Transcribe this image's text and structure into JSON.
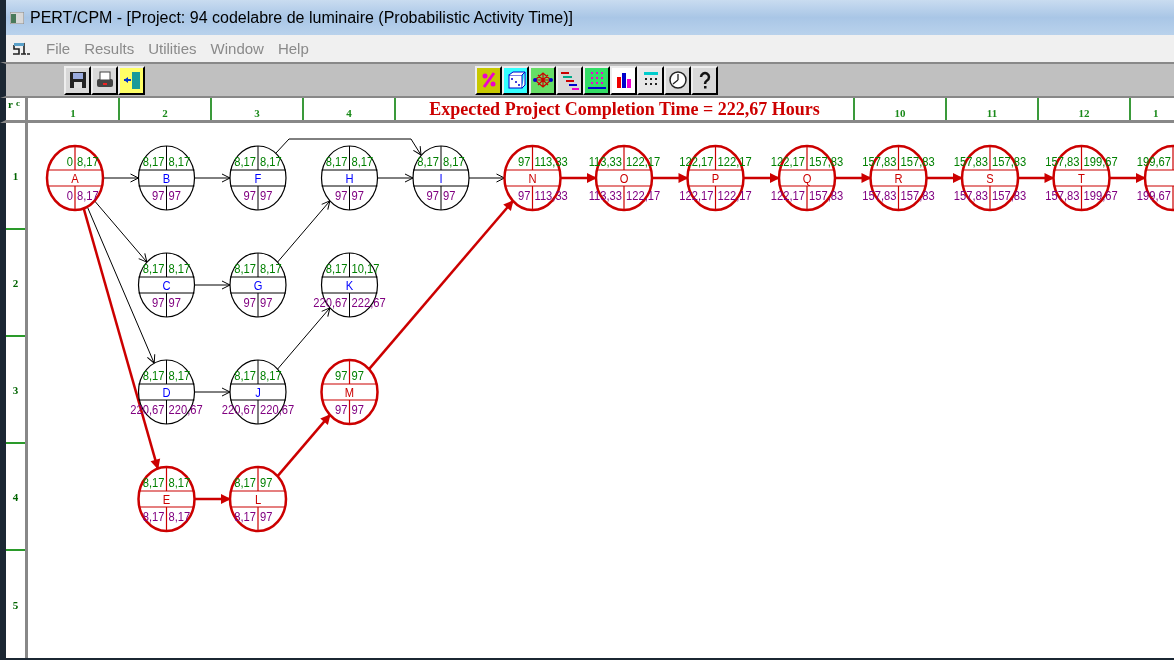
{
  "window": {
    "title": "PERT/CPM - [Project: 94 codelabre de luminaire (Probabilistic Activity Time)]"
  },
  "menu": [
    {
      "label": "File",
      "disabled": true
    },
    {
      "label": "Results",
      "disabled": true
    },
    {
      "label": "Utilities",
      "disabled": true
    },
    {
      "label": "Window",
      "disabled": true
    },
    {
      "label": "Help",
      "disabled": true
    }
  ],
  "toolbar": {
    "left": [
      {
        "kind": "save"
      },
      {
        "kind": "print"
      },
      {
        "kind": "exit"
      }
    ],
    "right": [
      {
        "kind": "percent"
      },
      {
        "kind": "dice"
      },
      {
        "kind": "network"
      },
      {
        "kind": "gantt"
      },
      {
        "kind": "grid"
      },
      {
        "kind": "bars"
      },
      {
        "kind": "calculator"
      },
      {
        "kind": "clock"
      },
      {
        "kind": "help"
      }
    ]
  },
  "grid": {
    "corner_row": "r",
    "corner_column": "c",
    "columns_before": [
      "1",
      "2",
      "3",
      "4"
    ],
    "summary": "Expected Project Completion Time = 222,67 Hours",
    "columns_after": [
      "10",
      "11",
      "12",
      "1"
    ],
    "rows": [
      "1",
      "2",
      "3",
      "4",
      "5"
    ]
  },
  "network": {
    "rows": [
      {
        "cells": [
          {
            "kind": "activity",
            "label": "A",
            "es": "0",
            "ef": "8,17",
            "ls": "0",
            "lf": "8,17",
            "critical": true
          },
          {
            "kind": "activity",
            "label": "B",
            "es": "8,17",
            "ef": "8,17",
            "ls": "97",
            "lf": "97",
            "critical": false
          },
          {
            "kind": "activity",
            "label": "F",
            "es": "8,17",
            "ef": "8,17",
            "ls": "97",
            "lf": "97",
            "critical": false
          },
          {
            "kind": "activity",
            "label": "H",
            "es": "8,17",
            "ef": "8,17",
            "ls": "97",
            "lf": "97",
            "critical": false
          },
          {
            "kind": "activity",
            "label": "I",
            "es": "8,17",
            "ef": "8,17",
            "ls": "97",
            "lf": "97",
            "critical": false
          },
          {
            "kind": "activity",
            "label": "N",
            "es": "97",
            "ef": "113,33",
            "ls": "97",
            "lf": "113,33",
            "critical": true
          },
          {
            "kind": "activity",
            "label": "O",
            "es": "113,33",
            "ef": "122,17",
            "ls": "113,33",
            "lf": "122,17",
            "critical": true
          },
          {
            "kind": "activity",
            "label": "P",
            "es": "122,17",
            "ef": "122,17",
            "ls": "122,17",
            "lf": "122,17",
            "critical": true
          },
          {
            "kind": "activity",
            "label": "Q",
            "es": "122,17",
            "ef": "157,83",
            "ls": "122,17",
            "lf": "157,83",
            "critical": true
          },
          {
            "kind": "activity",
            "label": "R",
            "es": "157,83",
            "ef": "157,83",
            "ls": "157,83",
            "lf": "157,83",
            "critical": true
          },
          {
            "kind": "activity",
            "label": "S",
            "es": "157,83",
            "ef": "157,83",
            "ls": "157,83",
            "lf": "157,83",
            "critical": true
          },
          {
            "kind": "activity",
            "label": "T",
            "es": "157,83",
            "ef": "199,67",
            "ls": "157,83",
            "lf": "199,67",
            "critical": true
          },
          {
            "kind": "activity",
            "es": "199,67",
            "ls": "199,67",
            "critical": true
          }
        ]
      },
      {
        "cells": [
          {
            "kind": "empty"
          },
          {
            "kind": "activity",
            "label": "C",
            "es": "8,17",
            "ef": "8,17",
            "ls": "97",
            "lf": "97",
            "critical": false
          },
          {
            "kind": "activity",
            "label": "G",
            "es": "8,17",
            "ef": "8,17",
            "ls": "97",
            "lf": "97",
            "critical": false
          },
          {
            "kind": "activity",
            "label": "K",
            "es": "8,17",
            "ef": "10,17",
            "ls": "220,67",
            "lf": "222,67",
            "critical": false
          }
        ]
      },
      {
        "cells": [
          {
            "kind": "empty"
          },
          {
            "kind": "activity",
            "label": "D",
            "es": "8,17",
            "ef": "8,17",
            "ls": "220,67",
            "lf": "220,67",
            "critical": false
          },
          {
            "kind": "activity",
            "label": "J",
            "es": "8,17",
            "ef": "8,17",
            "ls": "220,67",
            "lf": "220,67",
            "critical": false
          },
          {
            "kind": "activity",
            "label": "M",
            "es": "97",
            "ef": "97",
            "ls": "97",
            "lf": "97",
            "critical": true
          }
        ]
      },
      {
        "cells": [
          {
            "kind": "empty"
          },
          {
            "kind": "activity",
            "label": "E",
            "es": "8,17",
            "ef": "8,17",
            "ls": "8,17",
            "lf": "8,17",
            "critical": true
          },
          {
            "kind": "activity",
            "label": "L",
            "es": "8,17",
            "ef": "97",
            "ls": "8,17",
            "lf": "97",
            "critical": true
          }
        ]
      }
    ]
  }
}
